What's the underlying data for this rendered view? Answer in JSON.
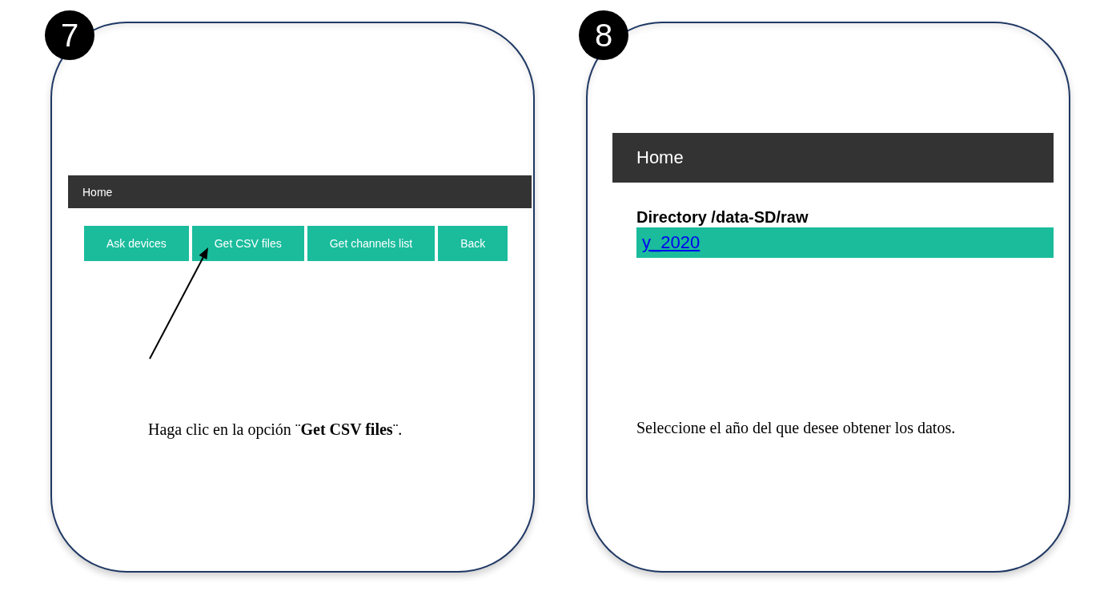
{
  "steps": [
    {
      "kind": "menu",
      "number": "7",
      "header": {
        "title": "Home"
      },
      "buttons": [
        {
          "label": "Ask devices"
        },
        {
          "label": "Get CSV files"
        },
        {
          "label": "Get channels list"
        },
        {
          "label": "Back"
        }
      ],
      "caption": "Haga clic en la opción ¨**Get CSV files**¨."
    },
    {
      "kind": "directory",
      "number": "8",
      "header": {
        "title": "Home"
      },
      "directory": {
        "heading": "Directory /data-SD/raw",
        "entries": [
          {
            "label": "y_2020"
          }
        ]
      },
      "caption": "Seleccione el año del que desee obtener los datos."
    }
  ]
}
